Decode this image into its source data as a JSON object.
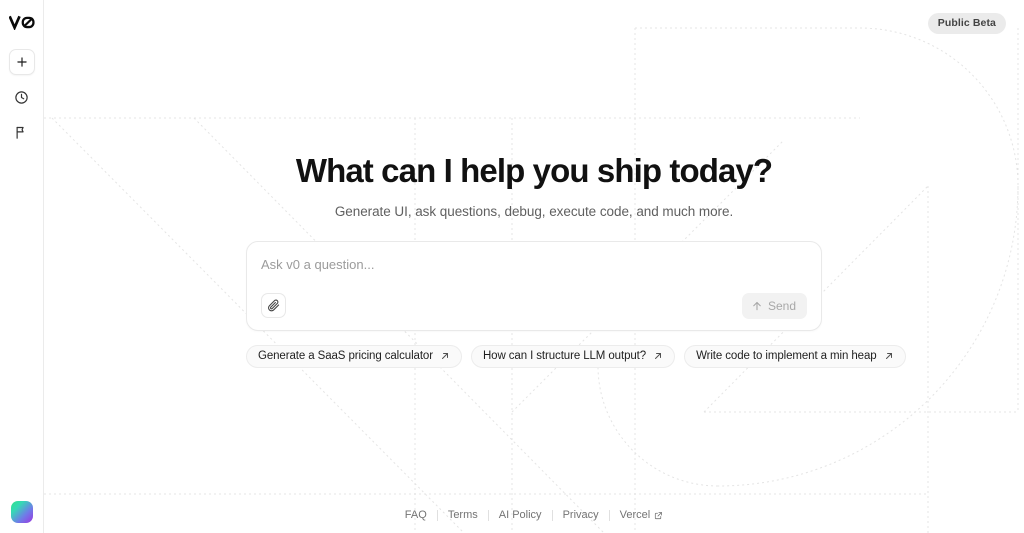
{
  "sidebar": {
    "logo": {
      "name": "v0-logo",
      "alt": "v0"
    },
    "items": [
      {
        "name": "new-chat-button",
        "icon": "plus-icon",
        "label": "New Chat"
      },
      {
        "name": "history-button",
        "icon": "clock-icon",
        "label": "History"
      },
      {
        "name": "feedback-button",
        "icon": "flag-icon",
        "label": "Feedback"
      }
    ],
    "avatar": {
      "name": "user-avatar",
      "label": "Account"
    }
  },
  "header": {
    "badge": "Public Beta"
  },
  "hero": {
    "headline": "What can I help you ship today?",
    "subhead": "Generate UI, ask questions, debug, execute code, and much more."
  },
  "composer": {
    "placeholder": "Ask v0 a question...",
    "value": "",
    "attach_label": "Attach file",
    "send_label": "Send",
    "send_icon": "arrow-up-icon"
  },
  "suggestions": [
    {
      "label": "Generate a SaaS pricing calculator",
      "icon": "arrow-up-right-icon"
    },
    {
      "label": "How can I structure LLM output?",
      "icon": "arrow-up-right-icon"
    },
    {
      "label": "Write code to implement a min heap",
      "icon": "arrow-up-right-icon"
    }
  ],
  "footer": {
    "links": [
      {
        "label": "FAQ",
        "external": false
      },
      {
        "label": "Terms",
        "external": false
      },
      {
        "label": "AI Policy",
        "external": false
      },
      {
        "label": "Privacy",
        "external": false
      },
      {
        "label": "Vercel",
        "external": true,
        "icon": "external-link-icon"
      }
    ]
  },
  "colors": {
    "background": "#ffffff",
    "text_primary": "#111111",
    "text_muted": "#606060",
    "border": "#ebebeb",
    "badge_bg": "#ebebeb",
    "send_bg": "#f2f2f2",
    "chip_bg": "#fafafa",
    "avatar_gradient_start": "#2fe28a",
    "avatar_gradient_end": "#9b35e0",
    "deco_line": "#e6e6e6"
  }
}
